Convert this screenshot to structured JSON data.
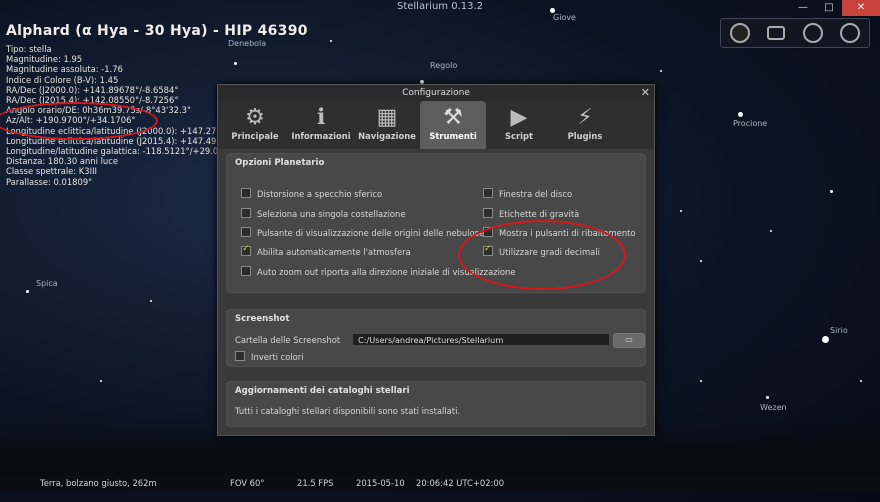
{
  "window": {
    "title": "Stellarium 0.13.2",
    "minimize": "—",
    "maximize": "□",
    "close": "✕"
  },
  "top_tools": [
    "moon-icon",
    "camera-icon",
    "target-icon",
    "quit-icon"
  ],
  "object_info": {
    "title": "Alphard (α Hya - 30 Hya) - HIP 46390",
    "lines": [
      "Tipo: stella",
      "Magnitudine: 1.95",
      "Magnitudine assoluta: -1.76",
      "Indice di Colore (B-V): 1.45",
      "RA/Dec (J2000.0): +141.89678°/-8.6584°",
      "RA/Dec (J2015.4): +142.08550°/-8.7256°",
      "Angolo orario/DE: 0h36m39.75s/-8°43'32.3\"",
      "Az/Alt: +190.9700°/+34.1706°",
      "Longitudine eclittica/latitudine (J2000.0): +147.27",
      "Longitudine eclittica/latitudine (J2015.4): +147.49",
      "Longitudine/latitudine galattica: -118.5121°/+29.0",
      "Distanza: 180.30 anni luce",
      "Classe spettrale: K3III",
      "Parallasse: 0.01809\""
    ]
  },
  "star_labels": [
    "Giove",
    "Denebola",
    "Regolo",
    "Procione",
    "Spica",
    "Sirio",
    "Wezen"
  ],
  "dialog": {
    "title": "Configurazione",
    "close": "✕",
    "tabs": [
      {
        "label": "Principale",
        "icon": "gear-icon",
        "glyph": "⚙"
      },
      {
        "label": "Informazioni",
        "icon": "info-icon",
        "glyph": "ℹ"
      },
      {
        "label": "Navigazione",
        "icon": "navigation-icon",
        "glyph": "▦"
      },
      {
        "label": "Strumenti",
        "icon": "tools-icon",
        "glyph": "⚒"
      },
      {
        "label": "Script",
        "icon": "play-icon",
        "glyph": "▶"
      },
      {
        "label": "Plugins",
        "icon": "plugin-icon",
        "glyph": "⚡"
      }
    ],
    "planetarium": {
      "title": "Opzioni Planetario",
      "left": [
        {
          "label": "Distorsione a specchio sferico",
          "checked": false
        },
        {
          "label": "Seleziona una singola costellazione",
          "checked": false
        },
        {
          "label": "Pulsante di visualizzazione delle origini delle nebulose",
          "checked": false
        },
        {
          "label": "Abilita automaticamente l'atmosfera",
          "checked": true
        },
        {
          "label": "Auto zoom out riporta alla direzione iniziale di visualizzazione",
          "checked": false
        }
      ],
      "right": [
        {
          "label": "Finestra del disco",
          "checked": false
        },
        {
          "label": "Etichette di gravità",
          "checked": false
        },
        {
          "label": "Mostra i pulsanti di ribaltamento",
          "checked": false
        },
        {
          "label": "Utilizzare gradi decimali",
          "checked": true
        }
      ]
    },
    "screenshot": {
      "title": "Screenshot",
      "folder_label": "Cartella delle Screenshot",
      "folder_value": "C:/Users/andrea/Pictures/Stellarium",
      "invert_label": "Inverti colori",
      "invert_checked": false
    },
    "catalogs": {
      "title": "Aggiornamenti dei cataloghi stellari",
      "text": "Tutti i cataloghi stellari disponibili sono stati installati."
    }
  },
  "status": {
    "location": "Terra, bolzano giusto, 262m",
    "fov": "FOV 60°",
    "fps": "21.5 FPS",
    "date": "2015-05-10",
    "time": "20:06:42 UTC+02:00"
  },
  "colors": {
    "annotation_red": "#d4191c",
    "check_yellow": "#e5c25a"
  }
}
